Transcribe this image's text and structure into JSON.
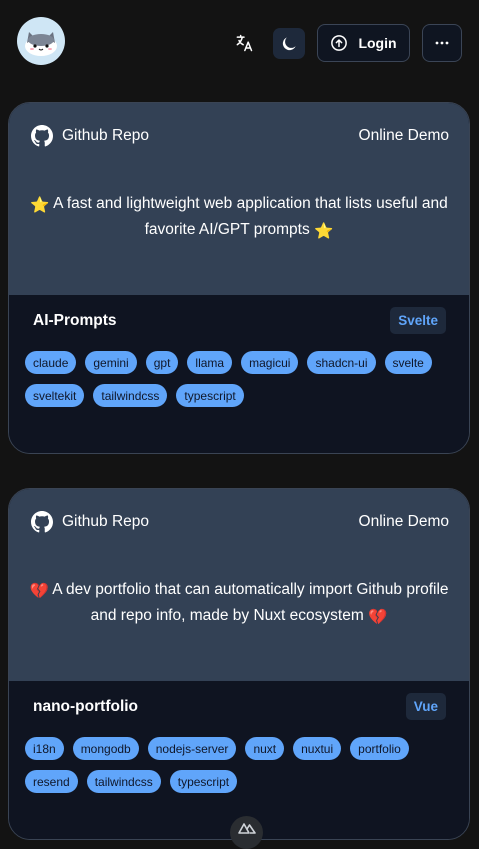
{
  "header": {
    "avatar_icon": "cat-avatar-icon",
    "translate_icon": "translate-icon",
    "theme_icon": "moon-icon",
    "login_label": "Login",
    "login_icon": "arrow-up-circle-icon",
    "more_icon": "ellipsis-icon"
  },
  "cards": [
    {
      "github_label": "Github Repo",
      "demo_label": "Online Demo",
      "desc_prefix": "⭐",
      "description": "A fast and lightweight web application that lists useful and favorite AI/GPT prompts",
      "desc_suffix": "⭐",
      "name": "AI-Prompts",
      "language": "Svelte",
      "tags": [
        "claude",
        "gemini",
        "gpt",
        "llama",
        "magicui",
        "shadcn-ui",
        "svelte",
        "sveltekit",
        "tailwindcss",
        "typescript"
      ]
    },
    {
      "github_label": "Github Repo",
      "demo_label": "Online Demo",
      "desc_prefix": "💔",
      "description": "A dev portfolio that can automatically import Github profile and repo info, made by Nuxt ecosystem",
      "desc_suffix": "💔",
      "name": "nano-portfolio",
      "language": "Vue",
      "tags": [
        "i18n",
        "mongodb",
        "nodejs-server",
        "nuxt",
        "nuxtui",
        "portfolio",
        "resend",
        "tailwindcss",
        "typescript"
      ]
    }
  ],
  "footer": {
    "scroll_icon": "nuxt-logo-icon"
  },
  "colors": {
    "accent": "#60a5fa",
    "card_top": "#334155",
    "card_bottom": "#0f1421",
    "background": "#131313"
  }
}
